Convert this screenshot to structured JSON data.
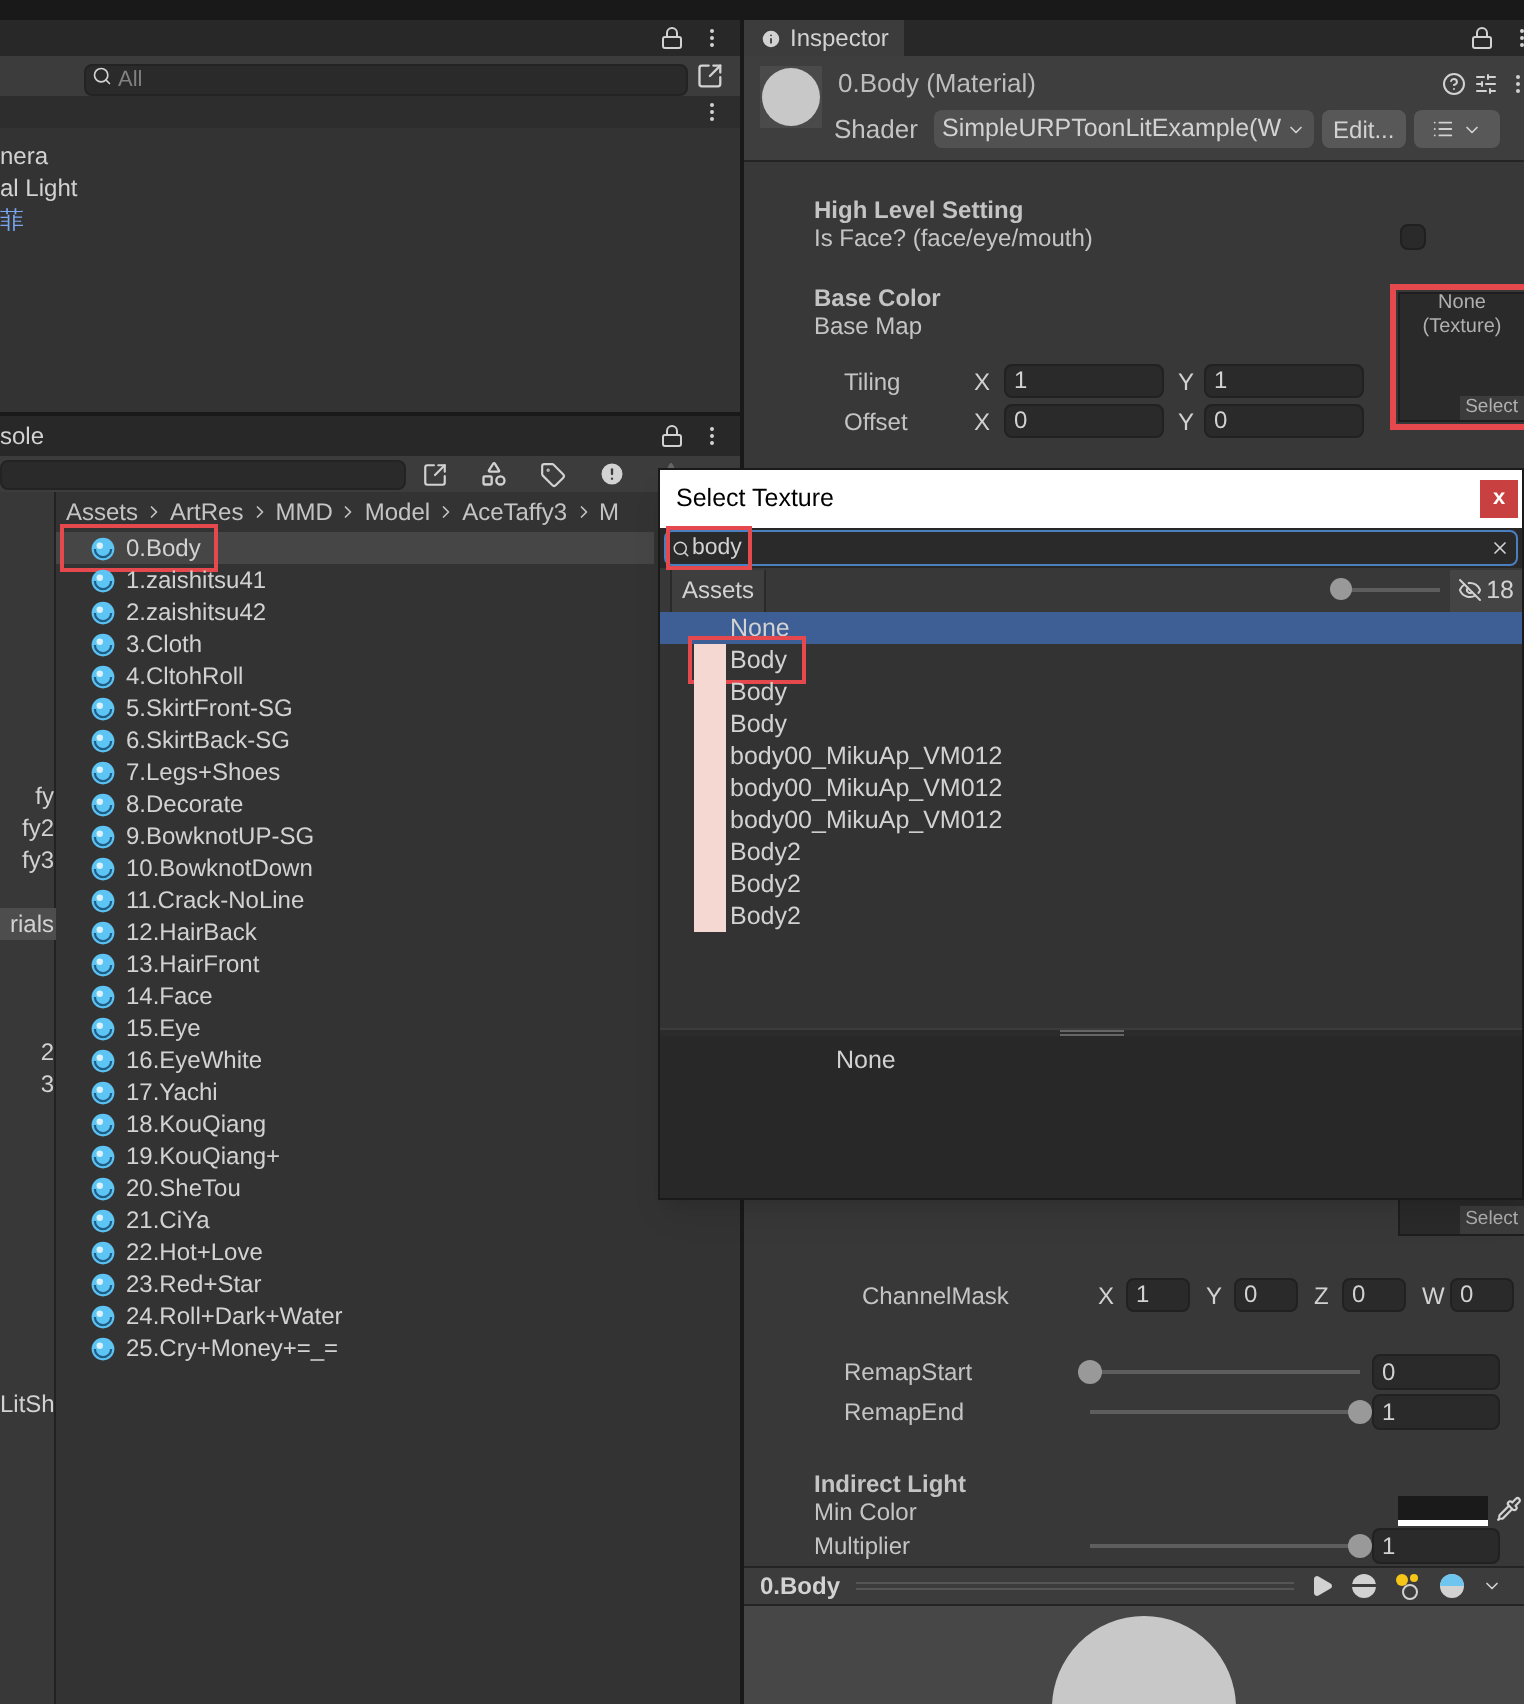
{
  "hierarchy": {
    "search": {
      "placeholder": "All"
    },
    "items": [
      {
        "label": "nera",
        "kind": "object"
      },
      {
        "label": "al Light",
        "kind": "object"
      },
      {
        "label": "菲",
        "kind": "prefab"
      }
    ]
  },
  "project": {
    "tab": "sole",
    "tree": [
      {
        "label": "fy",
        "selected": false
      },
      {
        "label": "fy2",
        "selected": false
      },
      {
        "label": "fy3",
        "selected": false
      },
      {
        "label": "rials",
        "selected": true
      },
      {
        "label": "2",
        "selected": false
      },
      {
        "label": "3",
        "selected": false
      },
      {
        "label": "LitSh",
        "selected": false
      }
    ],
    "breadcrumb": [
      "Assets",
      "ArtRes",
      "MMD",
      "Model",
      "AceTaffy3",
      "M"
    ],
    "materials": [
      {
        "name": "0.Body",
        "selected": true,
        "highlighted": true
      },
      {
        "name": "1.zaishitsu41",
        "selected": false,
        "highlighted": false
      },
      {
        "name": "2.zaishitsu42",
        "selected": false,
        "highlighted": false
      },
      {
        "name": "3.Cloth",
        "selected": false,
        "highlighted": false
      },
      {
        "name": "4.CltohRoll",
        "selected": false,
        "highlighted": false
      },
      {
        "name": "5.SkirtFront-SG",
        "selected": false,
        "highlighted": false
      },
      {
        "name": "6.SkirtBack-SG",
        "selected": false,
        "highlighted": false
      },
      {
        "name": "7.Legs+Shoes",
        "selected": false,
        "highlighted": false
      },
      {
        "name": "8.Decorate",
        "selected": false,
        "highlighted": false
      },
      {
        "name": "9.BowknotUP-SG",
        "selected": false,
        "highlighted": false
      },
      {
        "name": "10.BowknotDown",
        "selected": false,
        "highlighted": false
      },
      {
        "name": "11.Crack-NoLine",
        "selected": false,
        "highlighted": false
      },
      {
        "name": "12.HairBack",
        "selected": false,
        "highlighted": false
      },
      {
        "name": "13.HairFront",
        "selected": false,
        "highlighted": false
      },
      {
        "name": "14.Face",
        "selected": false,
        "highlighted": false
      },
      {
        "name": "15.Eye",
        "selected": false,
        "highlighted": false
      },
      {
        "name": "16.EyeWhite",
        "selected": false,
        "highlighted": false
      },
      {
        "name": "17.Yachi",
        "selected": false,
        "highlighted": false
      },
      {
        "name": "18.KouQiang",
        "selected": false,
        "highlighted": false
      },
      {
        "name": "19.KouQiang+",
        "selected": false,
        "highlighted": false
      },
      {
        "name": "20.SheTou",
        "selected": false,
        "highlighted": false
      },
      {
        "name": "21.CiYa",
        "selected": false,
        "highlighted": false
      },
      {
        "name": "22.Hot+Love",
        "selected": false,
        "highlighted": false
      },
      {
        "name": "23.Red+Star",
        "selected": false,
        "highlighted": false
      },
      {
        "name": "24.Roll+Dark+Water",
        "selected": false,
        "highlighted": false
      },
      {
        "name": "25.Cry+Money+=_=",
        "selected": false,
        "highlighted": false
      }
    ]
  },
  "inspector": {
    "tab": "Inspector",
    "title": "0.Body (Material)",
    "shader_label": "Shader",
    "shader": "SimpleURPToonLitExample(W",
    "edit_button": "Edit...",
    "high_level": {
      "heading": "High Level Setting",
      "is_face_label": "Is Face? (face/eye/mouth)",
      "is_face_checked": false
    },
    "base_color": {
      "heading": "Base Color",
      "map_label": "Base Map",
      "slot": {
        "line1": "None",
        "line2": "(Texture)",
        "button": "Select",
        "highlighted": true
      },
      "vectors": [
        {
          "label": "Tiling",
          "fields": [
            {
              "axis": "X",
              "value": "1"
            },
            {
              "axis": "Y",
              "value": "1"
            }
          ]
        },
        {
          "label": "Offset",
          "fields": [
            {
              "axis": "X",
              "value": "0"
            },
            {
              "axis": "Y",
              "value": "0"
            }
          ]
        }
      ]
    },
    "slot2_button": "Select",
    "channel_mask": {
      "label": "ChannelMask",
      "fields": [
        {
          "axis": "X",
          "value": "1"
        },
        {
          "axis": "Y",
          "value": "0"
        },
        {
          "axis": "Z",
          "value": "0"
        },
        {
          "axis": "W",
          "value": "0"
        }
      ]
    },
    "sliders": [
      {
        "label": "RemapStart",
        "level": 0,
        "value": "0"
      },
      {
        "label": "RemapEnd",
        "level": 1,
        "value": "1"
      }
    ],
    "indirect_light": {
      "heading": "Indirect Light",
      "min_color_label": "Min Color",
      "multiplier": {
        "label": "Multiplier",
        "level": 1,
        "value": "1"
      }
    },
    "preview": {
      "title": "0.Body"
    }
  },
  "dialog": {
    "title": "Select Texture",
    "close": "x",
    "search": "body",
    "search_highlighted": true,
    "tab": "Assets",
    "zoom_slider": {
      "level": 0
    },
    "count": "18",
    "results": [
      {
        "name": "None",
        "kind": "none",
        "selected": true,
        "highlighted": false
      },
      {
        "name": "Body",
        "kind": "texture",
        "selected": false,
        "highlighted": true
      },
      {
        "name": "Body",
        "kind": "texture",
        "selected": false,
        "highlighted": false
      },
      {
        "name": "Body",
        "kind": "texture",
        "selected": false,
        "highlighted": false
      },
      {
        "name": "body00_MikuAp_VM012",
        "kind": "texture",
        "selected": false,
        "highlighted": false
      },
      {
        "name": "body00_MikuAp_VM012",
        "kind": "texture",
        "selected": false,
        "highlighted": false
      },
      {
        "name": "body00_MikuAp_VM012",
        "kind": "texture",
        "selected": false,
        "highlighted": false
      },
      {
        "name": "Body2",
        "kind": "texture",
        "selected": false,
        "highlighted": false
      },
      {
        "name": "Body2",
        "kind": "texture",
        "selected": false,
        "highlighted": false
      },
      {
        "name": "Body2",
        "kind": "texture",
        "selected": false,
        "highlighted": false
      }
    ],
    "preview_label": "None"
  }
}
